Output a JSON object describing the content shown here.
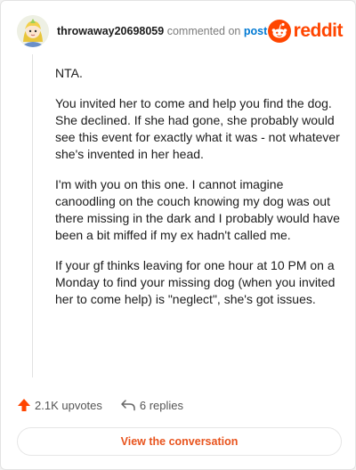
{
  "comment": {
    "username": "throwaway20698059",
    "verb": "commented on",
    "post_link": "post",
    "brand": "reddit",
    "paragraphs": [
      "NTA.",
      "You invited her to come and help you find the dog. She declined. If she had gone, she probably would see this event for exactly what it was - not whatever she's invented in her head.",
      "I'm with you on this one. I cannot imagine canoodling on the couch knowing my dog was out there missing in the dark and I probably would have been a bit miffed if my ex hadn't called me.",
      "If your gf thinks leaving for one hour at 10 PM on a Monday to find your missing dog (when you invited her to come help) is \"neglect\", she's got issues."
    ]
  },
  "actions": {
    "upvotes_label": "2.1K upvotes",
    "replies_label": "6 replies"
  },
  "cta": {
    "label": "View the conversation"
  },
  "colors": {
    "brand": "#ff4500",
    "upvote": "#ff4500",
    "link": "#0079d3",
    "cta_text": "#e8541e"
  },
  "icons": [
    "avatar",
    "reddit-logo-icon",
    "upvote-arrow-icon",
    "reply-arrow-icon"
  ]
}
